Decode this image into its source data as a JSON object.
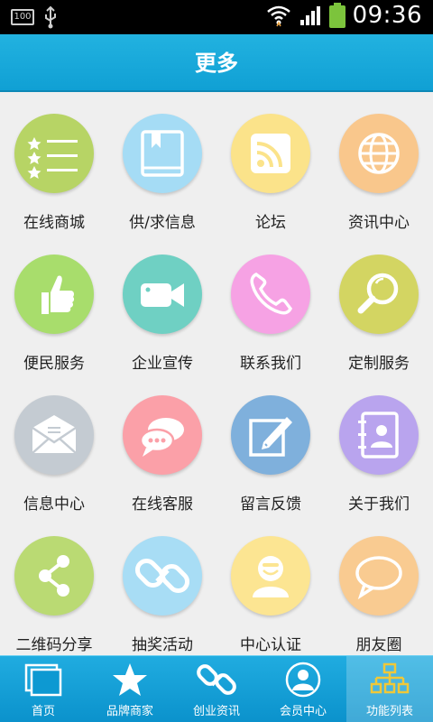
{
  "status_bar": {
    "battery_level_label": "100",
    "time": "09:36"
  },
  "header": {
    "title": "更多"
  },
  "menu": {
    "items": [
      {
        "label": "在线商城",
        "icon": "list-stars-icon",
        "color": "#b7d465"
      },
      {
        "label": "供/求信息",
        "icon": "book-icon",
        "color": "#a5dcf5"
      },
      {
        "label": "论坛",
        "icon": "rss-icon",
        "color": "#fbe38a"
      },
      {
        "label": "资讯中心",
        "icon": "globe-icon",
        "color": "#f9c78c"
      },
      {
        "label": "便民服务",
        "icon": "thumbs-up-icon",
        "color": "#a8dd6c"
      },
      {
        "label": "企业宣传",
        "icon": "video-camera-icon",
        "color": "#6fd0c3"
      },
      {
        "label": "联系我们",
        "icon": "phone-icon",
        "color": "#f6a2e4"
      },
      {
        "label": "定制服务",
        "icon": "magnifier-icon",
        "color": "#d3d562"
      },
      {
        "label": "信息中心",
        "icon": "envelope-icon",
        "color": "#c4cbd2"
      },
      {
        "label": "在线客服",
        "icon": "chat-bubbles-icon",
        "color": "#fba0a8"
      },
      {
        "label": "留言反馈",
        "icon": "edit-note-icon",
        "color": "#7fb0dc"
      },
      {
        "label": "关于我们",
        "icon": "contact-book-icon",
        "color": "#b9a4ee"
      },
      {
        "label": "二维码分享",
        "icon": "share-icon",
        "color": "#bada73"
      },
      {
        "label": "抽奖活动",
        "icon": "chain-link-icon",
        "color": "#a8ddf5"
      },
      {
        "label": "中心认证",
        "icon": "user-badge-icon",
        "color": "#fce592"
      },
      {
        "label": "朋友圈",
        "icon": "speech-bubble-icon",
        "color": "#f9cb91"
      }
    ]
  },
  "tabbar": {
    "tabs": [
      {
        "label": "首页",
        "icon": "windows-icon"
      },
      {
        "label": "品牌商家",
        "icon": "star-icon"
      },
      {
        "label": "创业资讯",
        "icon": "link-icon"
      },
      {
        "label": "会员中心",
        "icon": "user-icon"
      },
      {
        "label": "功能列表",
        "icon": "hierarchy-icon",
        "active": true
      }
    ]
  }
}
